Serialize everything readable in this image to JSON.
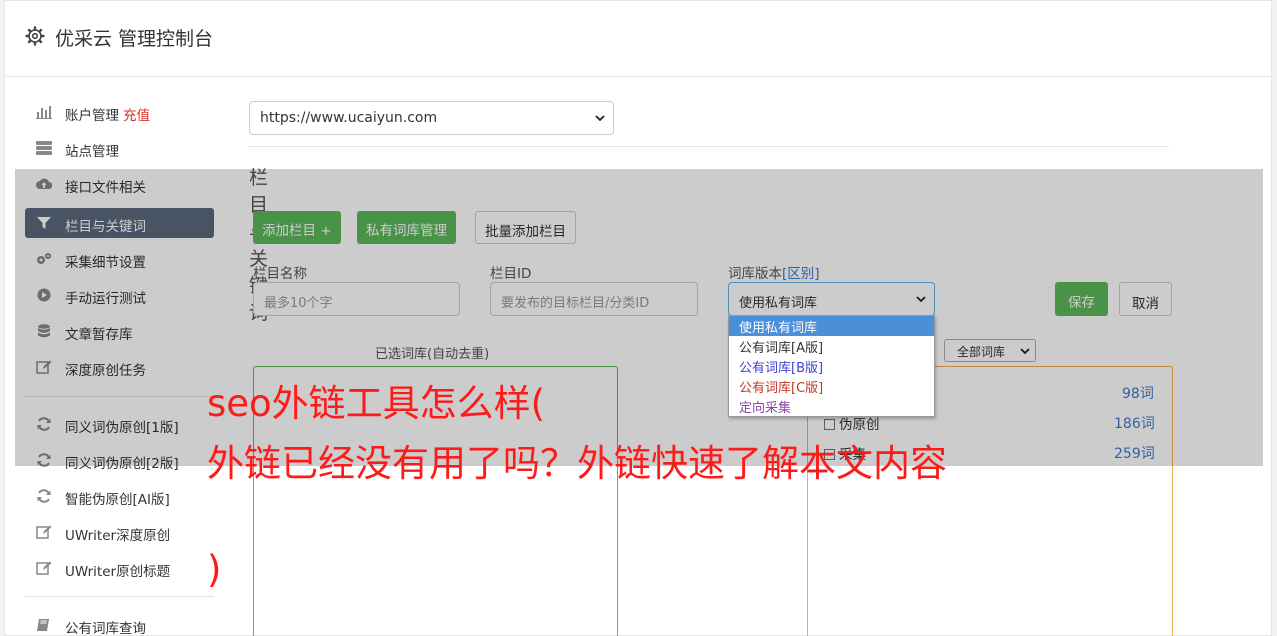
{
  "header": {
    "title": "优采云 管理控制台",
    "icon": "gear-icon"
  },
  "sidebar": {
    "items": [
      {
        "label": "账户管理",
        "badge": "充值",
        "icon": "bar-chart-icon"
      },
      {
        "label": "站点管理",
        "icon": "server-icon"
      },
      {
        "label": "接口文件相关",
        "icon": "cloud-upload-icon"
      },
      {
        "label": "栏目与关键词",
        "icon": "filter-icon",
        "active": true
      },
      {
        "label": "采集细节设置",
        "icon": "cogs-icon"
      },
      {
        "label": "手动运行测试",
        "icon": "play-circle-icon"
      },
      {
        "label": "文章暂存库",
        "icon": "database-icon"
      },
      {
        "label": "深度原创任务",
        "icon": "edit-icon"
      },
      {
        "label": "同义词伪原创[1版]",
        "icon": "refresh-icon"
      },
      {
        "label": "同义词伪原创[2版]",
        "icon": "refresh-icon"
      },
      {
        "label": "智能伪原创[AI版]",
        "icon": "refresh-icon"
      },
      {
        "label": "UWriter深度原创",
        "icon": "edit-icon"
      },
      {
        "label": "UWriter原创标题",
        "icon": "edit-icon"
      },
      {
        "label": "公有词库查询",
        "icon": "book-icon"
      }
    ]
  },
  "main": {
    "site_select": "https://www.ucaiyun.com",
    "section_title": "栏目与关键词",
    "buttons": {
      "add_column": "添加栏目 +",
      "private_lib": "私有词库管理",
      "batch_add": "批量添加栏目"
    },
    "form": {
      "name_label": "栏目名称",
      "name_placeholder": "最多10个字",
      "id_label": "栏目ID",
      "id_placeholder": "要发布的目标栏目/分类ID",
      "version_label": "词库版本",
      "version_link": "[区别]",
      "version_value": "使用私有词库",
      "save": "保存",
      "cancel": "取消"
    },
    "dropdown_options": [
      {
        "label": "使用私有词库",
        "color": "#ffffff",
        "selected": true
      },
      {
        "label": "公有词库[A版]",
        "color": "#333333"
      },
      {
        "label": "公有词库[B版]",
        "color": "#3f3fd6"
      },
      {
        "label": "公有词库[C版]",
        "color": "#c0392b"
      },
      {
        "label": "定向采集",
        "color": "#8e44ad"
      }
    ],
    "selected_lib_label": "已选词库(自动去重)",
    "all_lib_select": "全部词库",
    "lib_rows": [
      {
        "label": "",
        "count": "98词"
      },
      {
        "label": "伪原创",
        "count": "186词"
      },
      {
        "label": "采集",
        "count": "259词"
      }
    ]
  },
  "banner": {
    "line1": "seo外链工具怎么样(",
    "line2": "外链已经没有用了吗？外链快速了解本文内容",
    "line3": ")"
  }
}
